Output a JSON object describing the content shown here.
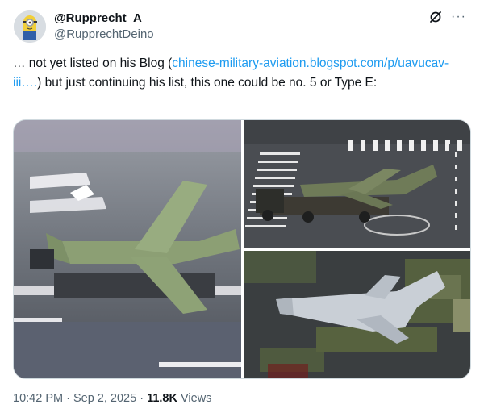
{
  "author": {
    "display_name": "@Rupprecht_A",
    "handle": "@RupprechtDeino",
    "avatar_icon": "minion-avatar"
  },
  "actions": {
    "grok_icon": "grok-icon",
    "more_icon": "more-dots-icon",
    "more_glyph": "···"
  },
  "tweet": {
    "text_part1": "… not yet listed on his Blog (",
    "link_text": "chinese-military-aviation.blogspot.com/p/uavucav-iii….",
    "text_part2": ") but just continuing his list, this one could be no. 5 or Type E:"
  },
  "media": {
    "count": 3,
    "items": [
      "aircraft-closeup-photo",
      "aircraft-on-transporter-photo",
      "aircraft-top-view-photo"
    ]
  },
  "meta": {
    "time": "10:42 PM",
    "sep1": " · ",
    "date": "Sep 2, 2025",
    "sep2": " · ",
    "views_count": "11.8K",
    "views_label": " Views"
  },
  "colors": {
    "link": "#1d9bf0",
    "secondary_text": "#536471",
    "primary_text": "#0f1419"
  }
}
